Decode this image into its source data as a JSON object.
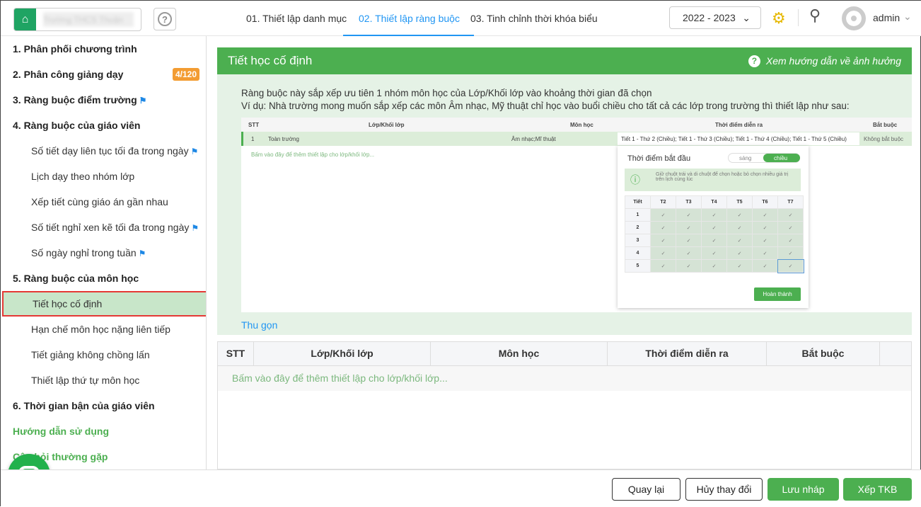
{
  "header": {
    "school_name": "Trường THCS Thuận Hóa",
    "help": "?",
    "tabs": [
      "01. Thiết lập danh mục",
      "02. Thiết lập ràng buộc",
      "03. Tinh chỉnh thời khóa biểu"
    ],
    "year": "2022 - 2023",
    "user": "admin"
  },
  "sidebar": {
    "items": [
      {
        "label": "1. Phân phối chương trình"
      },
      {
        "label": "2. Phân công giảng dạy",
        "badge": "4/120"
      },
      {
        "label": "3. Ràng buộc điểm trường"
      },
      {
        "label": "4. Ràng buộc của giáo viên"
      },
      {
        "label": "Số tiết dạy liên tục tối đa trong ngày"
      },
      {
        "label": "Lịch dạy theo nhóm lớp"
      },
      {
        "label": "Xếp tiết cùng giáo án gần nhau"
      },
      {
        "label": "Số tiết nghỉ xen kẽ tối đa trong ngày"
      },
      {
        "label": "Số ngày nghỉ trong tuần"
      },
      {
        "label": "5. Ràng buộc của môn học"
      },
      {
        "label": "Tiết học cố định"
      },
      {
        "label": "Hạn chế môn học nặng liên tiếp"
      },
      {
        "label": "Tiết giảng không chồng lấn"
      },
      {
        "label": "Thiết lập thứ tự môn học"
      },
      {
        "label": "6. Thời gian bận của giáo viên"
      },
      {
        "label": "Hướng dẫn sử dụng"
      },
      {
        "label": "Câu hỏi thường gặp"
      }
    ]
  },
  "main": {
    "title": "Tiết học cố định",
    "guide": "Xem hướng dẫn về ảnh hưởng",
    "desc1": "Ràng buộc này sắp xếp ưu tiên 1 nhóm môn học của Lớp/Khối lớp vào khoảng thời gian đã chọn",
    "desc2": "Ví dụ: Nhà trường mong muốn sắp xếp các môn Âm nhạc, Mỹ thuật chỉ học vào buổi chiều cho tất cả các lớp trong trường thì thiết lập như sau:",
    "example": {
      "headers": [
        "STT",
        "Lớp/Khối lớp",
        "Môn học",
        "Thời điểm diễn ra",
        "Bắt buộc"
      ],
      "row": [
        "1",
        "Toàn trường",
        "Âm nhạc;Mĩ thuật",
        "Tiết 1 - Thứ 2 (Chiều); Tiết 1 - Thứ 3 (Chiều); Tiết 1 - Thứ 4 (Chiều); Tiết 1 - Thứ 5 (Chiều)",
        "Không bắt buộc"
      ],
      "add": "Bấm vào đây để thêm thiết lập cho lớp/khối lớp...",
      "popup": {
        "title": "Thời điểm bắt đầu",
        "morning": "sáng",
        "afternoon": "chiều",
        "hint": "Giữ chuột trái và di chuột để chọn hoặc bỏ chọn nhiều giá trị trên lịch cùng lúc",
        "col_header": "Tiết",
        "days": [
          "T2",
          "T3",
          "T4",
          "T5",
          "T6",
          "T7"
        ],
        "periods": [
          "1",
          "2",
          "3",
          "4",
          "5"
        ],
        "done": "Hoàn thành"
      }
    },
    "collapse": "Thu gọn",
    "table": {
      "headers": [
        "STT",
        "Lớp/Khối lớp",
        "Môn học",
        "Thời điểm diễn ra",
        "Bắt buộc"
      ],
      "add": "Bấm vào đây để thêm thiết lập cho lớp/khối lớp..."
    }
  },
  "footer": {
    "back": "Quay lại",
    "cancel": "Hủy thay đổi",
    "draft": "Lưu nháp",
    "schedule": "Xếp TKB"
  }
}
